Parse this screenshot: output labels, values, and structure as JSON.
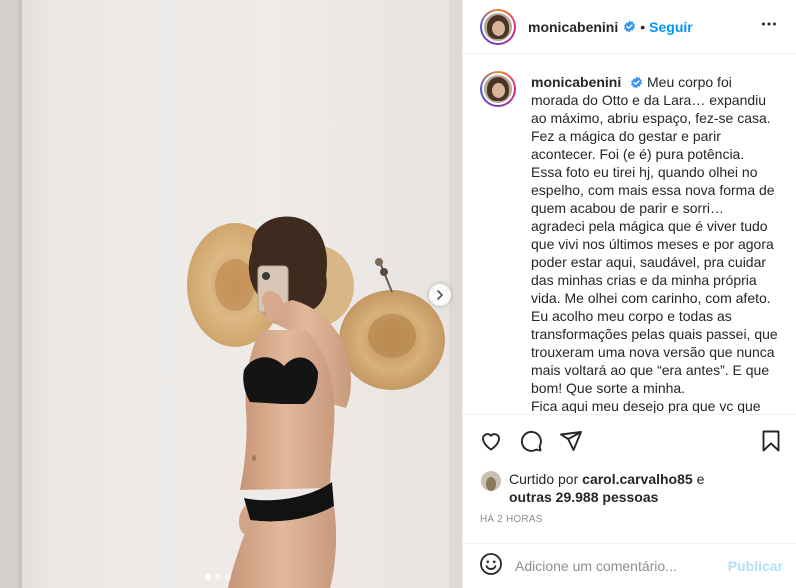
{
  "post": {
    "photo_alt": "Foto de monicabenini",
    "carousel": {
      "total_slides": 3,
      "active_slide": 1
    }
  },
  "header": {
    "username": "monicabenini",
    "separator": "•",
    "follow_label": "Seguir"
  },
  "caption": {
    "username": "monicabenini",
    "paragraphs": [
      "Meu corpo foi morada do Otto e da Lara… expandiu ao máximo, abriu espaço, fez-se casa. Fez a mágica do gestar e parir acontecer. Foi (e é) pura potência.",
      "Essa foto eu tirei hj, quando olhei no espelho, com mais essa nova forma de quem acabou de parir e sorri… agradeci pela mágica que é viver tudo que vivi nos últimos meses e por agora poder estar aqui, saudável, pra cuidar das minhas crias e da minha própria vida. Me olhei com carinho, com afeto.",
      "Eu acolho meu corpo e todas as transformações pelas quais passei, que trouxeram uma nova versão que nunca mais voltará ao que “era antes”. E que bom! Que sorte a minha.",
      "Fica aqui meu desejo pra que vc que"
    ]
  },
  "likes": {
    "prefix": "Curtido por",
    "user": "carol.carvalho85",
    "conjunction": "e",
    "others": "outras 29.988 pessoas"
  },
  "timestamp": "HÁ 2 HORAS",
  "comment_box": {
    "placeholder": "Adicione um comentário...",
    "publish_label": "Publicar"
  },
  "icons": {
    "like": "heart-icon",
    "comment": "comment-icon",
    "share": "paper-plane-icon",
    "save": "bookmark-icon",
    "emoji": "emoji-icon",
    "options": "more-options-icon",
    "verified": "verified-badge-icon",
    "next": "chevron-right-icon"
  },
  "colors": {
    "accent_blue": "#0095f6",
    "publish_disabled": "#b2dffc",
    "muted_text": "#8e8e8e",
    "divider": "#efefef"
  }
}
